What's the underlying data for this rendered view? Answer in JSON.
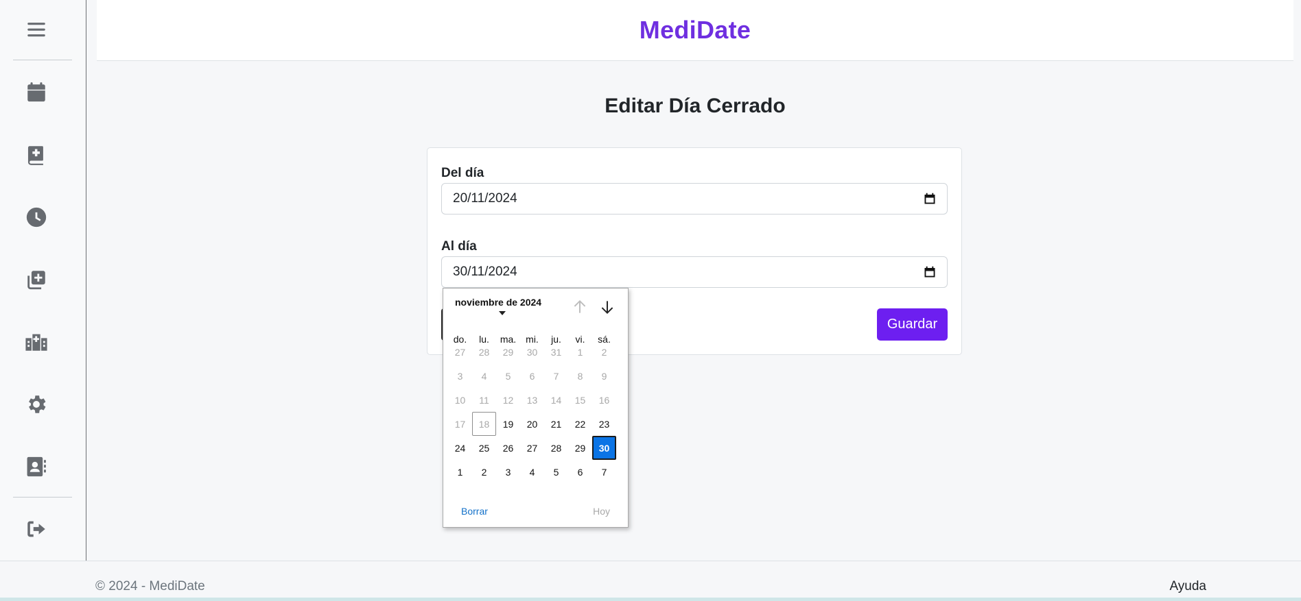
{
  "app": {
    "brand": "MediDate"
  },
  "sidebar": {
    "items": [
      {
        "name": "menu-icon"
      },
      {
        "name": "calendar-icon"
      },
      {
        "name": "medical-book-icon"
      },
      {
        "name": "clock-icon"
      },
      {
        "name": "add-copy-icon"
      },
      {
        "name": "hospital-icon"
      },
      {
        "name": "gear-icon"
      },
      {
        "name": "contact-card-icon"
      },
      {
        "name": "logout-icon"
      }
    ]
  },
  "page": {
    "title": "Editar Día Cerrado"
  },
  "form": {
    "from_label": "Del día",
    "from_value": "20/11/2024",
    "to_label": "Al día",
    "to_value": "30/11/2024",
    "save_label": "Guardar"
  },
  "datepicker": {
    "month_label": "noviembre de 2024",
    "weekdays": [
      "do.",
      "lu.",
      "ma.",
      "mi.",
      "ju.",
      "vi.",
      "sá."
    ],
    "weeks": [
      [
        {
          "d": "27",
          "m": true
        },
        {
          "d": "28",
          "m": true
        },
        {
          "d": "29",
          "m": true
        },
        {
          "d": "30",
          "m": true
        },
        {
          "d": "31",
          "m": true
        },
        {
          "d": "1",
          "m": true
        },
        {
          "d": "2",
          "m": true
        }
      ],
      [
        {
          "d": "3",
          "m": true
        },
        {
          "d": "4",
          "m": true
        },
        {
          "d": "5",
          "m": true
        },
        {
          "d": "6",
          "m": true
        },
        {
          "d": "7",
          "m": true
        },
        {
          "d": "8",
          "m": true
        },
        {
          "d": "9",
          "m": true
        }
      ],
      [
        {
          "d": "10",
          "m": true
        },
        {
          "d": "11",
          "m": true
        },
        {
          "d": "12",
          "m": true
        },
        {
          "d": "13",
          "m": true
        },
        {
          "d": "14",
          "m": true
        },
        {
          "d": "15",
          "m": true
        },
        {
          "d": "16",
          "m": true
        }
      ],
      [
        {
          "d": "17",
          "m": true
        },
        {
          "d": "18",
          "m": true,
          "today": true
        },
        {
          "d": "19"
        },
        {
          "d": "20"
        },
        {
          "d": "21"
        },
        {
          "d": "22"
        },
        {
          "d": "23"
        }
      ],
      [
        {
          "d": "24"
        },
        {
          "d": "25"
        },
        {
          "d": "26"
        },
        {
          "d": "27"
        },
        {
          "d": "28"
        },
        {
          "d": "29"
        },
        {
          "d": "30",
          "selected": true
        }
      ],
      [
        {
          "d": "1"
        },
        {
          "d": "2"
        },
        {
          "d": "3"
        },
        {
          "d": "4"
        },
        {
          "d": "5"
        },
        {
          "d": "6"
        },
        {
          "d": "7"
        }
      ]
    ],
    "clear_label": "Borrar",
    "today_label": "Hoy"
  },
  "footer": {
    "copyright": "© 2024 - MediDate",
    "help": "Ayuda"
  },
  "colors": {
    "brand": "#6f2fe0",
    "primary_button": "#6d1ff0",
    "selected_day": "#0b74e5"
  }
}
